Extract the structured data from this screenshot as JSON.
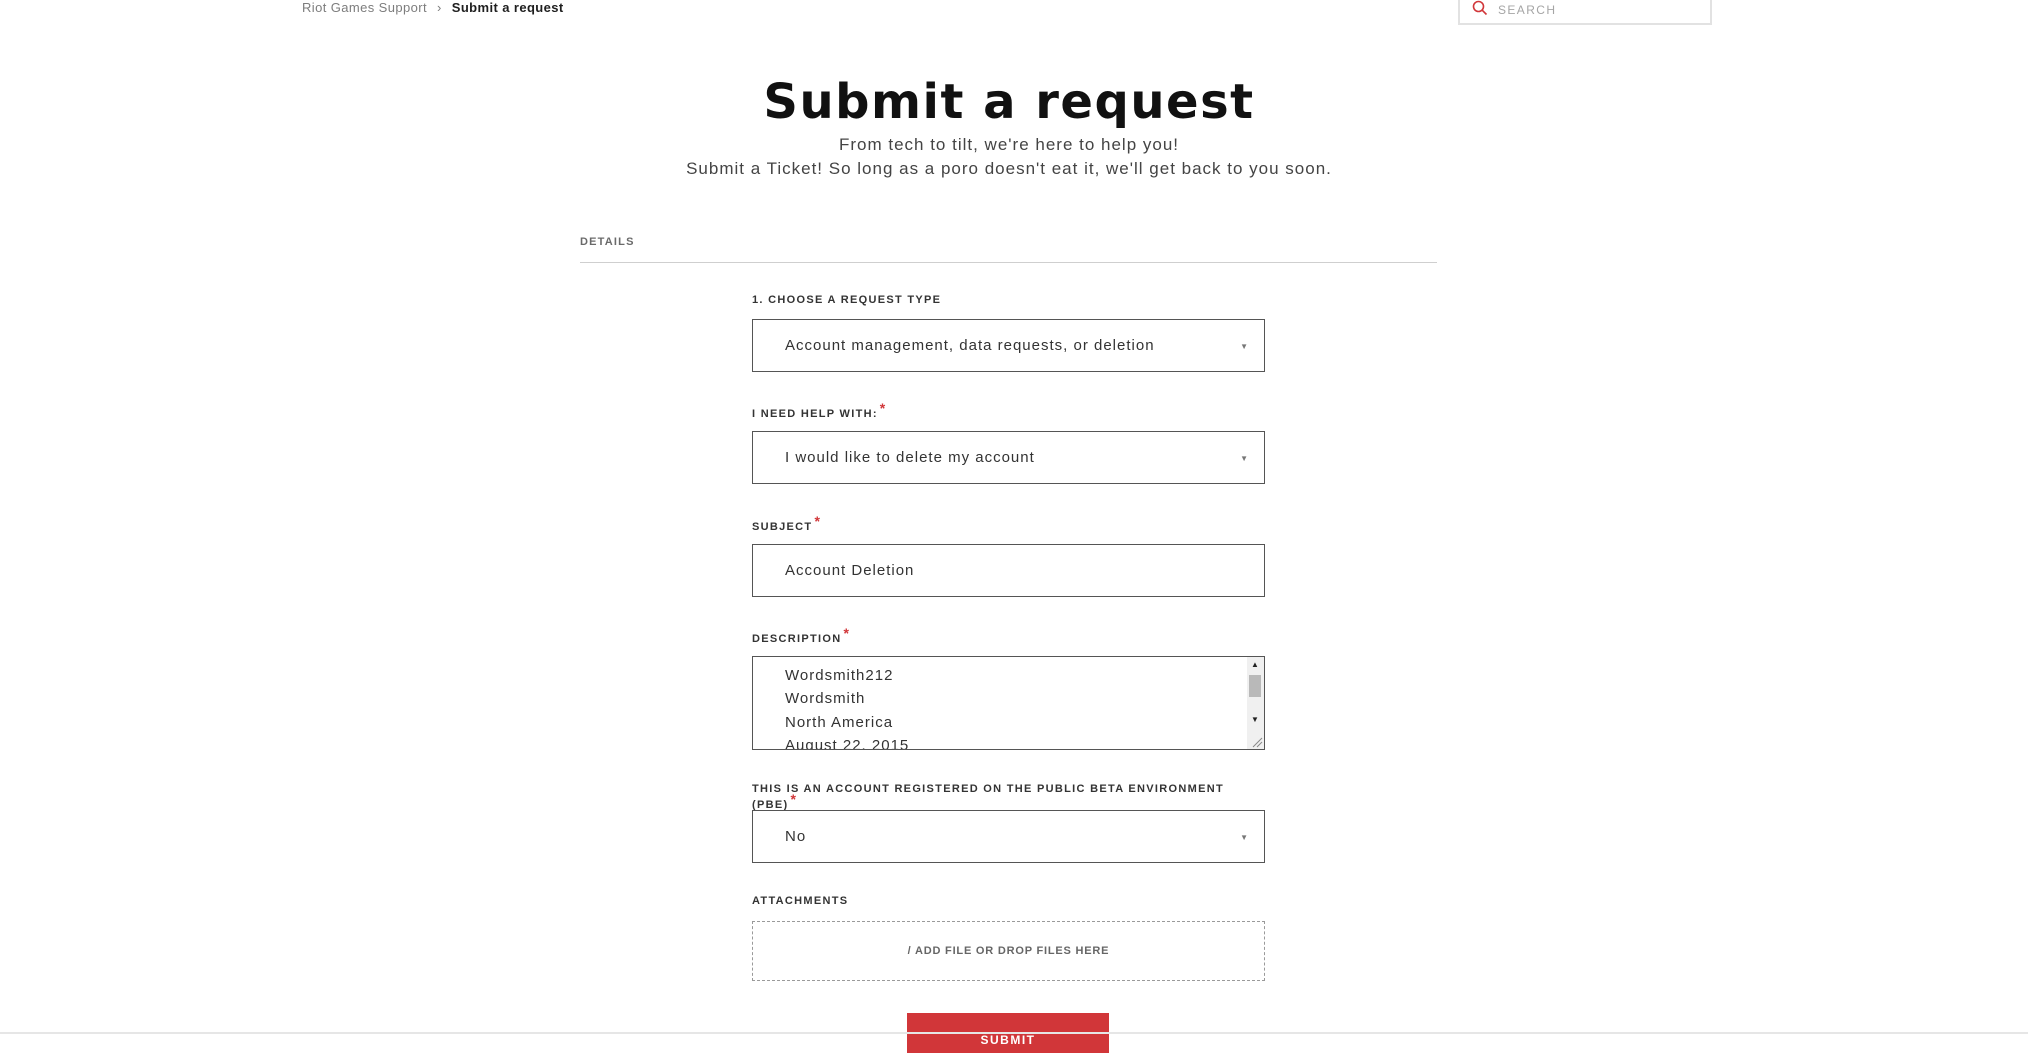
{
  "breadcrumb": {
    "home": "Riot Games Support",
    "separator": "›",
    "current": "Submit a request"
  },
  "search": {
    "placeholder": "SEARCH"
  },
  "header": {
    "title": "Submit a request",
    "subtitle_line1": "From tech to tilt, we're here to help you!",
    "subtitle_line2": "Submit a Ticket! So long as a poro doesn't eat it, we'll get back to you soon."
  },
  "section": {
    "label": "DETAILS"
  },
  "form": {
    "request_type": {
      "label": "1. CHOOSE A REQUEST TYPE",
      "value": "Account management, data requests, or deletion"
    },
    "help_with": {
      "label": "I NEED HELP WITH:",
      "value": "I would like to delete my account"
    },
    "subject": {
      "label": "SUBJECT",
      "value": "Account Deletion"
    },
    "description": {
      "label": "DESCRIPTION",
      "lines": [
        "Wordsmith212",
        "Wordsmith",
        "North America",
        "August 22, 2015"
      ]
    },
    "pbe": {
      "label": "THIS IS AN ACCOUNT REGISTERED ON THE PUBLIC BETA ENVIRONMENT (PBE)",
      "value": "No"
    },
    "attachments": {
      "label": "ATTACHMENTS",
      "dropzone": "/ ADD FILE OR DROP FILES HERE"
    },
    "required_marker": "*",
    "submit_label": "SUBMIT"
  },
  "colors": {
    "accent": "#d13639",
    "text": "#333333",
    "muted": "#7d7d7d",
    "border": "#555555"
  }
}
